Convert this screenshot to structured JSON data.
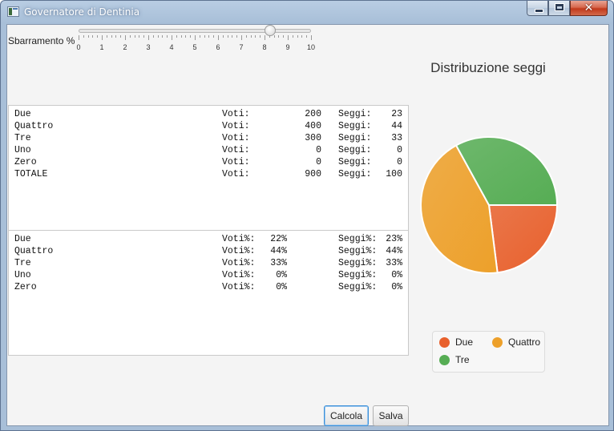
{
  "window": {
    "title": "Governatore di Dentinia",
    "close_label": "✕"
  },
  "slider": {
    "label": "Sbarramento %",
    "min": 0,
    "max": 10,
    "value": 8.2,
    "tick_labels": [
      "0",
      "1",
      "2",
      "3",
      "4",
      "5",
      "6",
      "7",
      "8",
      "9",
      "10"
    ]
  },
  "votes_table": {
    "voti_label": "Voti:",
    "seggi_label": "Seggi:",
    "rows": [
      {
        "name": "Due",
        "voti": "200",
        "seggi": "23"
      },
      {
        "name": "Quattro",
        "voti": "400",
        "seggi": "44"
      },
      {
        "name": "Tre",
        "voti": "300",
        "seggi": "33"
      },
      {
        "name": "Uno",
        "voti": "0",
        "seggi": "0"
      },
      {
        "name": "Zero",
        "voti": "0",
        "seggi": "0"
      },
      {
        "name": "TOTALE",
        "voti": "900",
        "seggi": "100"
      }
    ]
  },
  "percent_table": {
    "voti_label": "Voti%:",
    "seggi_label": "Seggi%:",
    "rows": [
      {
        "name": "Due",
        "voti": "22%",
        "seggi": "23%"
      },
      {
        "name": "Quattro",
        "voti": "44%",
        "seggi": "44%"
      },
      {
        "name": "Tre",
        "voti": "33%",
        "seggi": "33%"
      },
      {
        "name": "Uno",
        "voti": "0%",
        "seggi": "0%"
      },
      {
        "name": "Zero",
        "voti": "0%",
        "seggi": "0%"
      }
    ]
  },
  "chart_data": {
    "type": "pie",
    "title": "Distribuzione seggi",
    "categories": [
      "Due",
      "Quattro",
      "Tre"
    ],
    "values": [
      23,
      44,
      33
    ],
    "colors": [
      "#e8602c",
      "#eda02a",
      "#56ad54"
    ],
    "legend": [
      "Due",
      "Quattro",
      "Tre"
    ],
    "legend_position": "bottom"
  },
  "buttons": {
    "calcola": "Calcola",
    "salva": "Salva"
  }
}
